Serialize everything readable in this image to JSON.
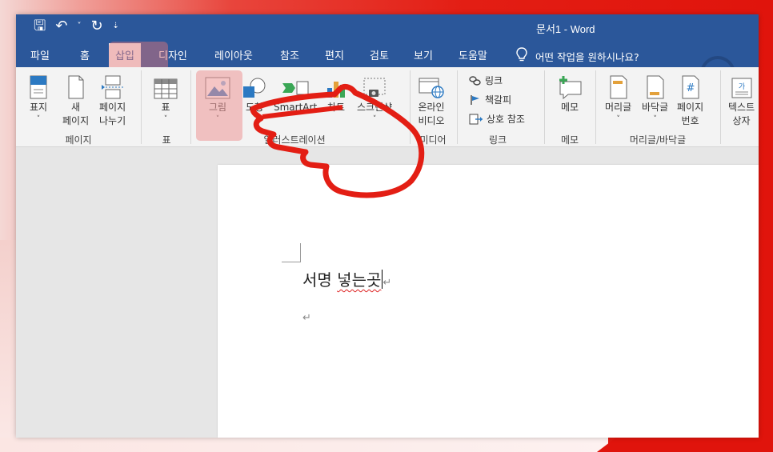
{
  "window": {
    "title": "문서1  -  Word"
  },
  "qat": {
    "save": "🖫",
    "undo": "↶",
    "dropdown": "˅",
    "redo": "↻",
    "customize": "⇣"
  },
  "tabs": [
    {
      "label": "파일"
    },
    {
      "label": "홈"
    },
    {
      "label": "삽입"
    },
    {
      "label": "디자인"
    },
    {
      "label": "레이아웃"
    },
    {
      "label": "참조"
    },
    {
      "label": "편지"
    },
    {
      "label": "검토"
    },
    {
      "label": "보기"
    },
    {
      "label": "도움말"
    }
  ],
  "tell_me": "어떤 작업을 원하시나요?",
  "ribbon": {
    "groups": {
      "pages": "페이지",
      "tables": "표",
      "illustrations": "일러스트레이션",
      "media": "미디어",
      "links": "링크",
      "comments": "메모",
      "header_footer": "머리글/바닥글"
    },
    "buttons": {
      "cover_1": "표지",
      "new_page_1": "새",
      "new_page_2": "페이지",
      "page_break_1": "페이지",
      "page_break_2": "나누기",
      "table": "표",
      "pictures": "그림",
      "shapes": "도형",
      "smartart": "SmartArt",
      "chart": "차트",
      "screenshot": "스크린샷",
      "online_video_1": "온라인",
      "online_video_2": "비디오",
      "link": "링크",
      "bookmark": "책갈피",
      "cross_ref": "상호 참조",
      "comment": "메모",
      "header": "머리글",
      "footer": "바닥글",
      "page_number_1": "페이지",
      "page_number_2": "번호",
      "textbox_1": "텍스트",
      "textbox_2": "상자"
    },
    "caret": "˅"
  },
  "document": {
    "line1_word1": "서명",
    "line1_word2": "넣는곳",
    "para_mark": "↵"
  },
  "colors": {
    "title_bar": "#2b579a",
    "highlight": "#ec9696",
    "annotation": "#e31e14"
  }
}
